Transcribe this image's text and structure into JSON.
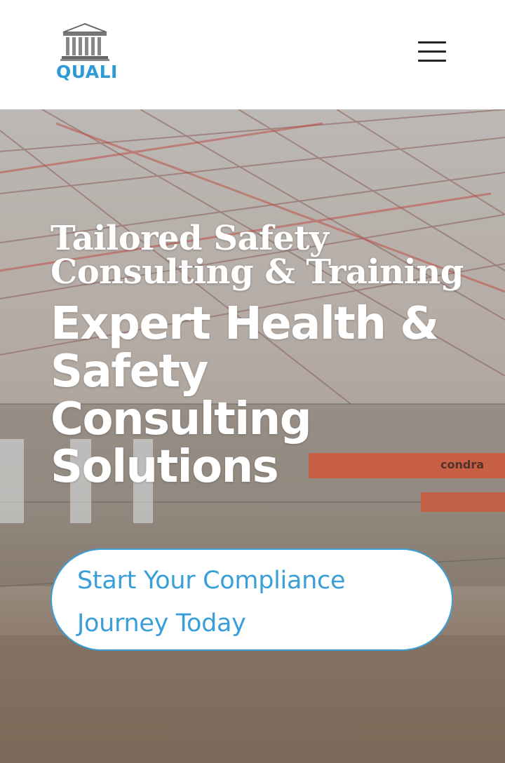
{
  "header": {
    "logo_text": "QUALI",
    "menu_icon": "hamburger-menu-icon"
  },
  "hero": {
    "tagline": "Tailored Safety Consulting & Training",
    "headline": "Expert Health & Safety Consulting Solutions",
    "cta_label": "Start Your Compliance Journey Today",
    "background_signage": "condra"
  },
  "colors": {
    "brand_blue": "#3a9fd8",
    "header_bg": "#ffffff",
    "text_on_hero": "#ffffff"
  }
}
